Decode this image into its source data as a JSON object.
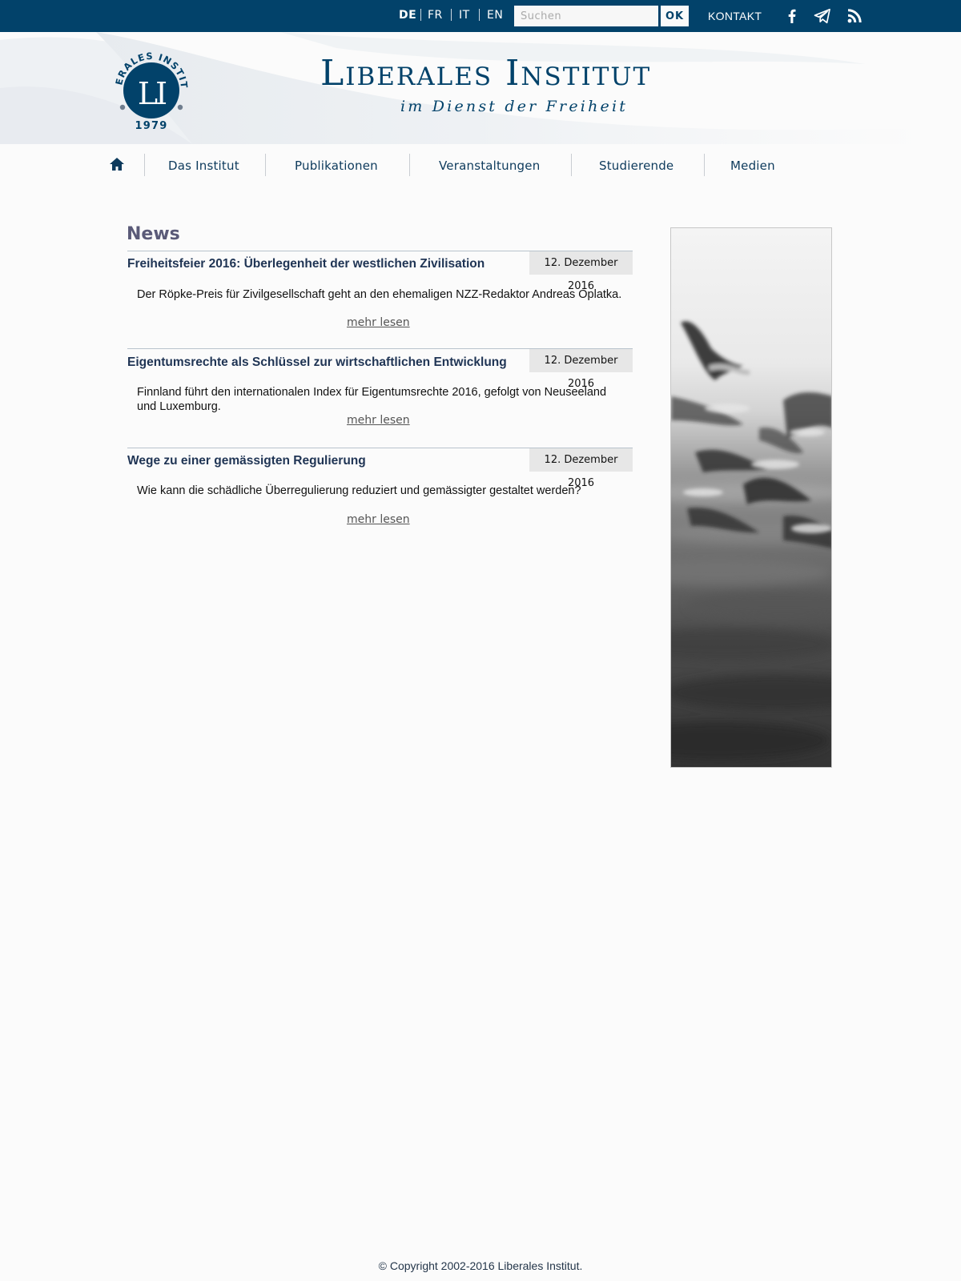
{
  "topbar": {
    "languages": [
      {
        "code": "DE",
        "active": true
      },
      {
        "code": "FR",
        "active": false
      },
      {
        "code": "IT",
        "active": false
      },
      {
        "code": "EN",
        "active": false
      }
    ],
    "search_placeholder": "Suchen",
    "search_button": "OK",
    "contact_label": "KONTAKT",
    "social_icons": [
      "facebook-icon",
      "telegram-icon",
      "rss-icon"
    ],
    "background_color": "#02426a"
  },
  "header": {
    "title": "Liberales Institut",
    "tagline": "im Dienst der Freiheit",
    "logo_ring_text": "LIBERALES INSTITUT",
    "logo_monogram": "LI",
    "logo_year": "1979"
  },
  "nav": {
    "home_icon": "home-icon",
    "items": [
      "Das Institut",
      "Publikationen",
      "Veranstaltungen",
      "Studierende",
      "Medien"
    ]
  },
  "news": {
    "heading": "News",
    "more_label": "mehr lesen",
    "articles": [
      {
        "title": "Freiheitsfeier 2016: Überlegenheit der westlichen Zivilisation",
        "date": "12. Dezember 2016",
        "summary": "Der Röpke-Preis für Zivilgesellschaft geht an den ehemaligen NZZ-Redaktor Andreas Oplatka."
      },
      {
        "title": "Eigentumsrechte als Schlüssel zur wirtschaftlichen Entwick­lung",
        "date": "12. Dezember 2016",
        "summary": "Finnland führt den internationalen Index für Eigentumsrechte 2016, gefolgt von Neuseeland und Luxemburg."
      },
      {
        "title": "Wege zu einer gemässigten Regulierung",
        "date": "12. Dezember 2016",
        "summary": "Wie kann die schädliche Überregulierung reduziert und gemässigter gestaltet werden?"
      }
    ]
  },
  "sidebar": {
    "image": "seagulls-photo"
  },
  "footer": {
    "copyright": "© Copyright 2002-2016 Liberales Institut."
  }
}
